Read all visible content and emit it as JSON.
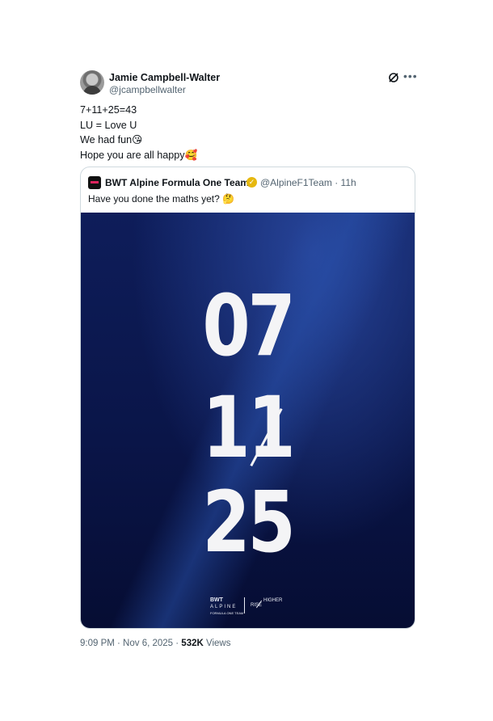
{
  "author": {
    "name": "Jamie Campbell-Walter",
    "handle": "@jcampbellwalter"
  },
  "tweet_lines": [
    "7+11+25=43",
    "LU = Love U",
    "We had fun😘",
    "Hope you are all happy🥰"
  ],
  "quoted": {
    "name": "BWT Alpine Formula One Team",
    "handle_time": "@AlpineF1Team · 11h",
    "text": "Have you done the maths yet? 🤔",
    "media": {
      "numbers": [
        "07",
        "11",
        "25"
      ],
      "brand_top": "BWT",
      "brand_main": "ALPINE",
      "brand_sub": "FORMULA ONE TEAM",
      "slogan_a": "RISE",
      "slogan_b": "HIGHER"
    }
  },
  "footer": {
    "time_date": "9:09 PM · Nov 6, 2025 · ",
    "views_count": "532K",
    "views_label": " Views"
  },
  "icons": {
    "more": "more-icon",
    "grok": "grok-icon",
    "verified": "verified-badge-icon"
  }
}
